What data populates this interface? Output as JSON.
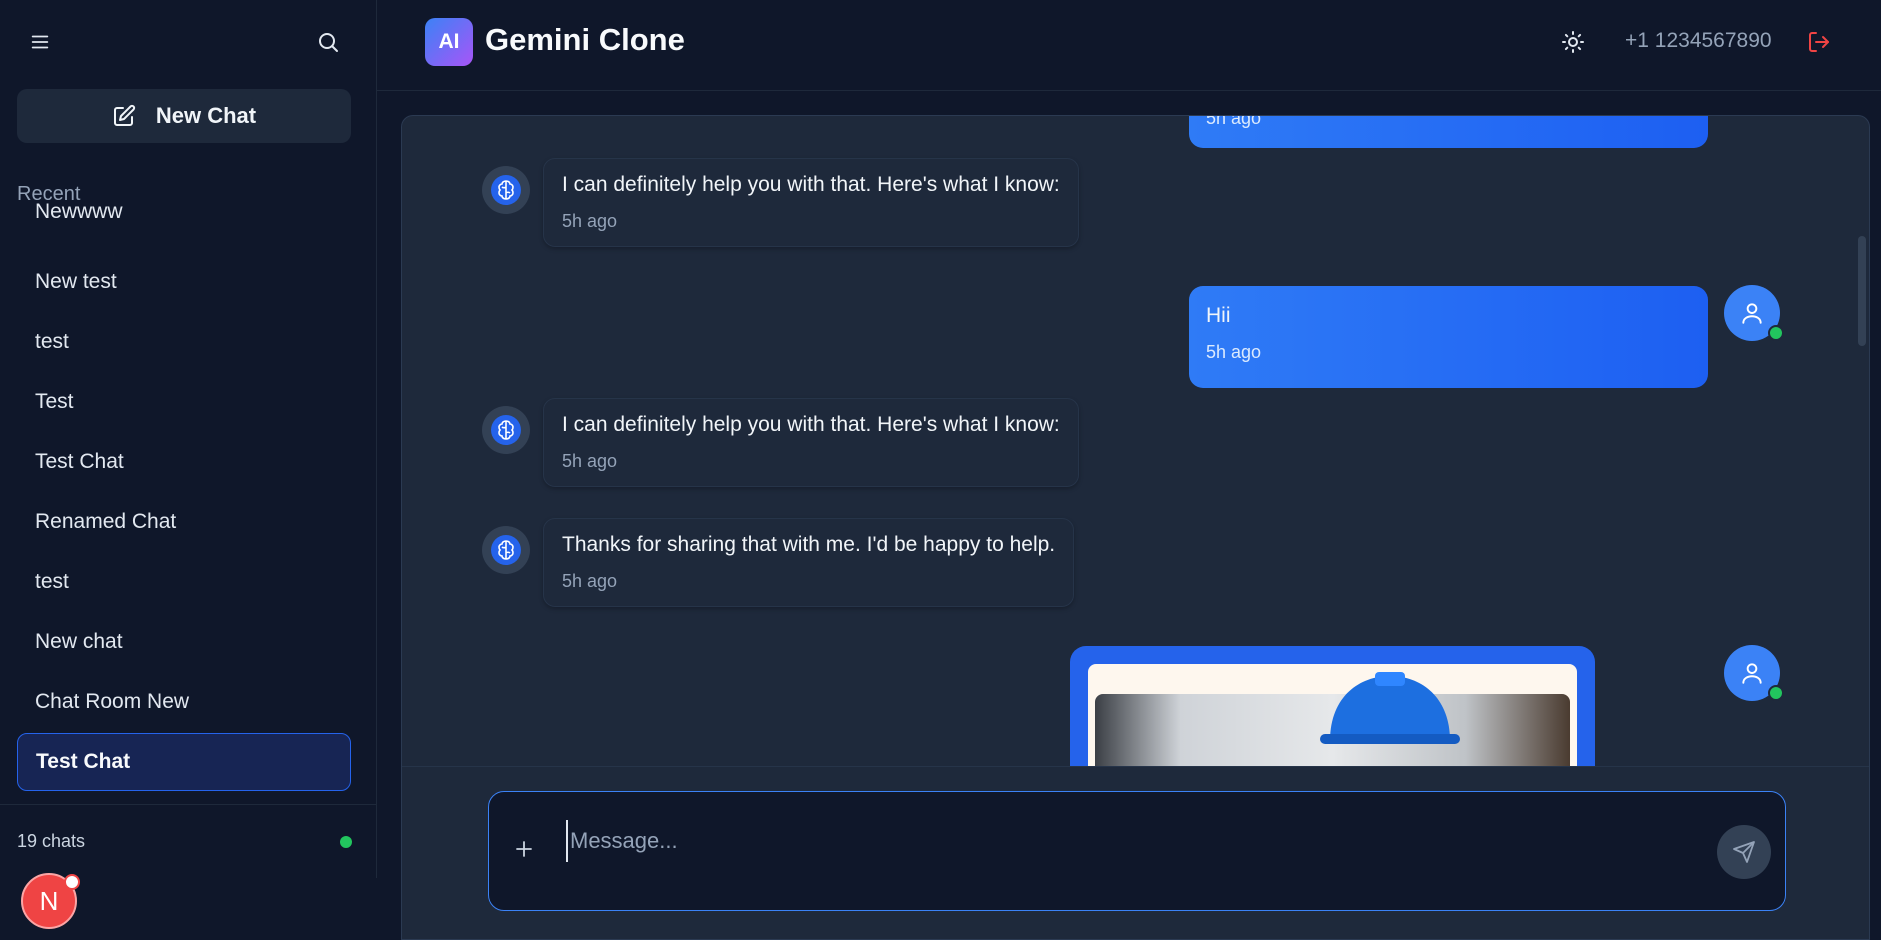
{
  "sidebar": {
    "new_chat_label": "New Chat",
    "recent_label": "Recent",
    "items": [
      {
        "label": "Newwww"
      },
      {
        "label": "New test"
      },
      {
        "label": "test"
      },
      {
        "label": "Test"
      },
      {
        "label": "Test Chat"
      },
      {
        "label": "Renamed Chat"
      },
      {
        "label": "test"
      },
      {
        "label": "New chat"
      },
      {
        "label": "Chat Room New"
      },
      {
        "label": "Test Chat"
      }
    ],
    "active_index": 9,
    "chat_count": "19 chats",
    "user_initial": "N"
  },
  "header": {
    "logo_text": "AI",
    "title": "Gemini Clone",
    "phone": "+1 1234567890"
  },
  "messages": [
    {
      "role": "user",
      "text": "",
      "time": "5h ago"
    },
    {
      "role": "bot",
      "text": "I can definitely help you with that. Here's what I know:",
      "time": "5h ago"
    },
    {
      "role": "user",
      "text": "Hii",
      "time": "5h ago"
    },
    {
      "role": "bot",
      "text": "I can definitely help you with that. Here's what I know:",
      "time": "5h ago"
    },
    {
      "role": "bot",
      "text": "Thanks for sharing that with me. I'd be happy to help.",
      "time": "5h ago"
    },
    {
      "role": "user",
      "type": "image"
    }
  ],
  "composer": {
    "placeholder": "Message..."
  },
  "colors": {
    "background": "#0f172a",
    "panel": "#1e293b",
    "accent": "#2563eb",
    "online": "#22c55e",
    "danger": "#ef4444"
  },
  "icons": [
    "menu-icon",
    "search-icon",
    "edit-icon",
    "sun-icon",
    "logout-icon",
    "brain-icon",
    "user-icon",
    "plus-icon",
    "send-icon"
  ]
}
